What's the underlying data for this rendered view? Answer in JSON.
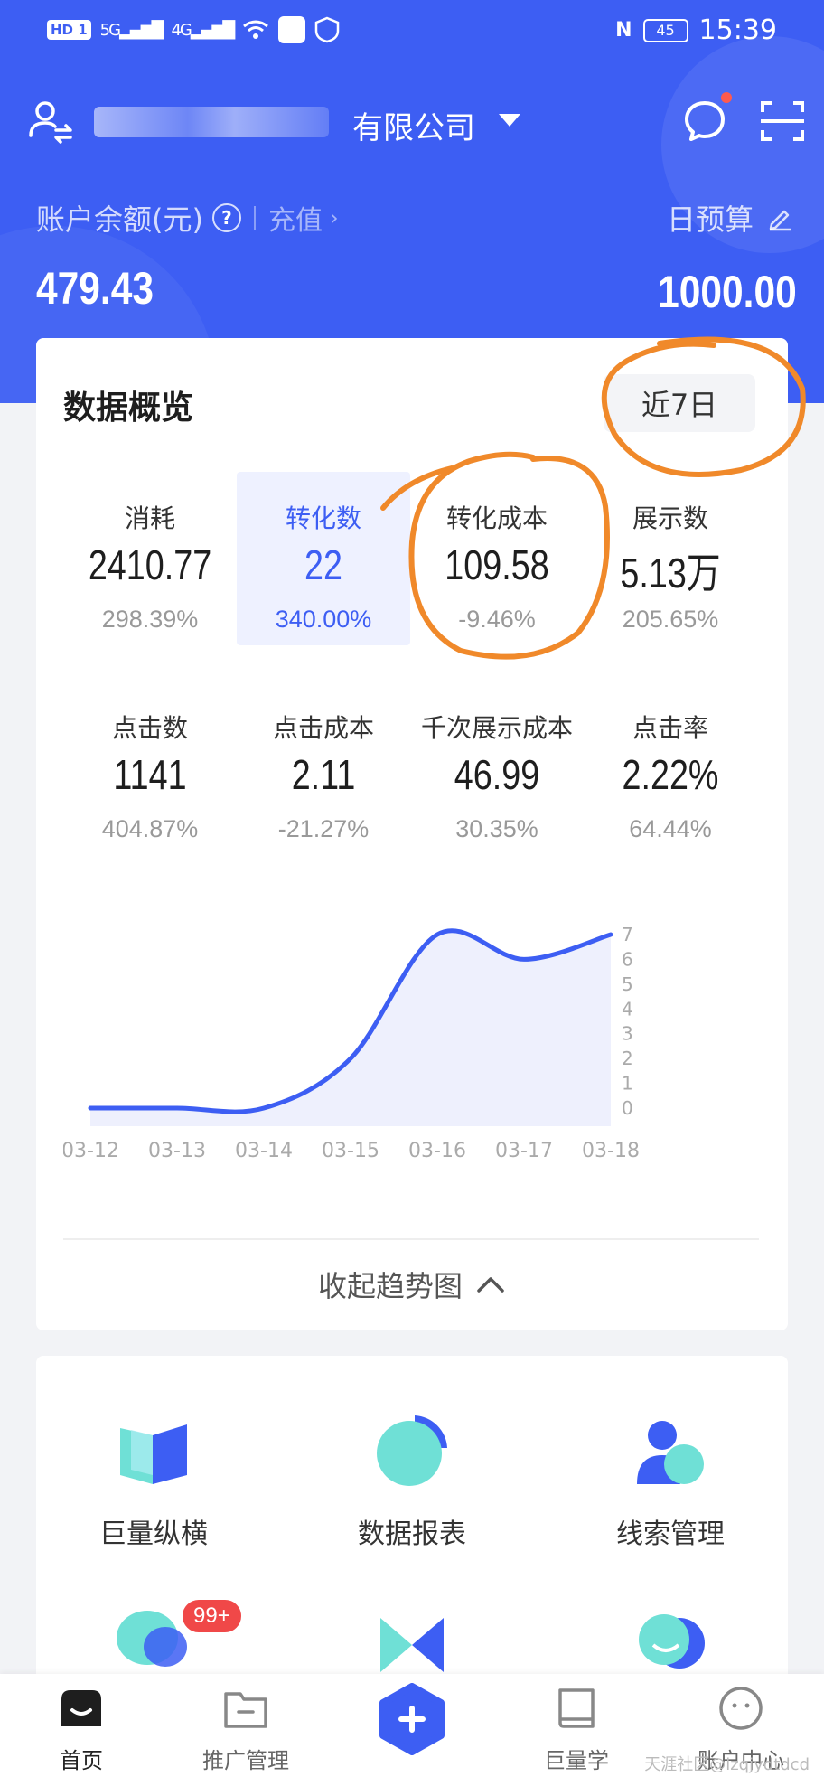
{
  "status_bar": {
    "network_chip": "HD 1",
    "signal_1": "5G",
    "signal_2": "4G",
    "nfc": "N",
    "battery": "45",
    "time": "15:39"
  },
  "header": {
    "company_suffix": "有限公司",
    "balance_label": "账户余额(元)",
    "help_glyph": "?",
    "recharge_label": "充值",
    "budget_label": "日预算",
    "balance_value": "479.43",
    "budget_value": "1000.00"
  },
  "overview": {
    "title": "数据概览",
    "range_label": "近7日",
    "metrics": [
      {
        "label": "消耗",
        "value": "2410.77",
        "change": "298.39%"
      },
      {
        "label": "转化数",
        "value": "22",
        "change": "340.00%"
      },
      {
        "label": "转化成本",
        "value": "109.58",
        "change": "-9.46%"
      },
      {
        "label": "展示数",
        "value": "5.13万",
        "change": "205.65%"
      },
      {
        "label": "点击数",
        "value": "1141",
        "change": "404.87%"
      },
      {
        "label": "点击成本",
        "value": "2.11",
        "change": "-21.27%"
      },
      {
        "label": "千次展示成本",
        "value": "46.99",
        "change": "30.35%"
      },
      {
        "label": "点击率",
        "value": "2.22%",
        "change": "64.44%"
      }
    ],
    "collapse_label": "收起趋势图"
  },
  "chart_data": {
    "type": "area",
    "x": [
      "03-12",
      "03-13",
      "03-14",
      "03-15",
      "03-16",
      "03-17",
      "03-18"
    ],
    "series": [
      {
        "values": [
          0,
          0,
          0,
          2,
          7,
          6,
          7
        ]
      }
    ],
    "yticks": [
      0,
      1,
      2,
      3,
      4,
      5,
      6,
      7
    ],
    "ylim": [
      0,
      7
    ],
    "y_axis_side": "right",
    "line_color": "#3d5ef3",
    "fill_color": "#eef0fd",
    "grid": false
  },
  "tools": [
    {
      "label": "巨量纵横"
    },
    {
      "label": "数据报表"
    },
    {
      "label": "线索管理"
    }
  ],
  "tools_badge": "99+",
  "tabbar": [
    {
      "label": "首页"
    },
    {
      "label": "推广管理"
    },
    {
      "label": "巨量学"
    },
    {
      "label": "账户中心"
    }
  ],
  "watermark": "天涯社区@lzqjydtdcd",
  "colors": {
    "brand_blue": "#3d5ef3",
    "annotation_orange": "#f0892a",
    "badge_red": "#f04848"
  }
}
